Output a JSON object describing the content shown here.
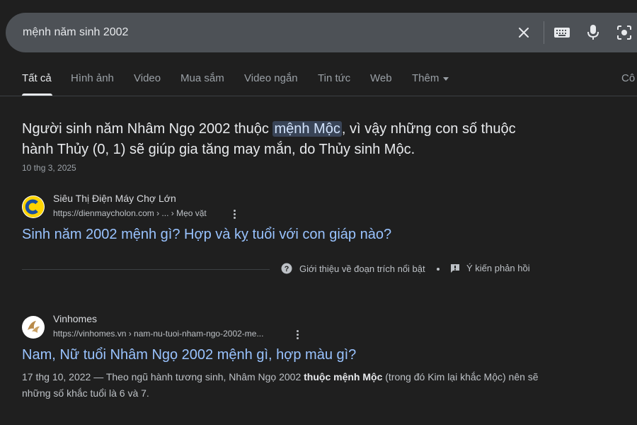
{
  "search": {
    "query": "mệnh năm sinh 2002"
  },
  "tabs": [
    {
      "label": "Tất cả"
    },
    {
      "label": "Hình ảnh"
    },
    {
      "label": "Video"
    },
    {
      "label": "Mua sắm"
    },
    {
      "label": "Video ngắn"
    },
    {
      "label": "Tin tức"
    },
    {
      "label": "Web"
    },
    {
      "label": "Thêm"
    },
    {
      "label": "Cô"
    }
  ],
  "featured_snippet": {
    "text_before": "Người sinh năm Nhâm Ngọ 2002 thuộc ",
    "highlight": "mệnh Mộc",
    "text_after": ", vì vậy những con số thuộc hành Thủy (0, 1) sẽ giúp gia tăng may mắn, do Thủy sinh Mộc.",
    "date": "10 thg 3, 2025",
    "about_label": "Giới thiệu về đoạn trích nổi bật",
    "feedback_label": "Ý kiến phản hồi"
  },
  "results": [
    {
      "site_name": "Siêu Thị Điện Máy Chợ Lớn",
      "url": "https://dienmaycholon.com › ... › Mẹo vặt",
      "title": "Sinh năm 2002 mệnh gì? Hợp và kỵ tuổi với con giáp nào?"
    },
    {
      "site_name": "Vinhomes",
      "url": "https://vinhomes.vn › nam-nu-tuoi-nham-ngo-2002-me...",
      "title": "Nam, Nữ tuổi Nhâm Ngọ 2002 mệnh gì, hợp màu gì?",
      "desc_date": "17 thg 10, 2022",
      "desc_dash": " — ",
      "desc_before": "Theo ngũ hành tương sinh, Nhâm Ngọ 2002 ",
      "desc_bold": "thuộc mệnh Mộc",
      "desc_after": " (trong đó Kim lại khắc Mộc) nên sẽ những số khắc tuổi là 6 và 7."
    }
  ],
  "colors": {
    "background": "#1f1f1f",
    "search_bar": "#4d5156",
    "link": "#99c3ff",
    "highlight_bg": "#394457"
  }
}
